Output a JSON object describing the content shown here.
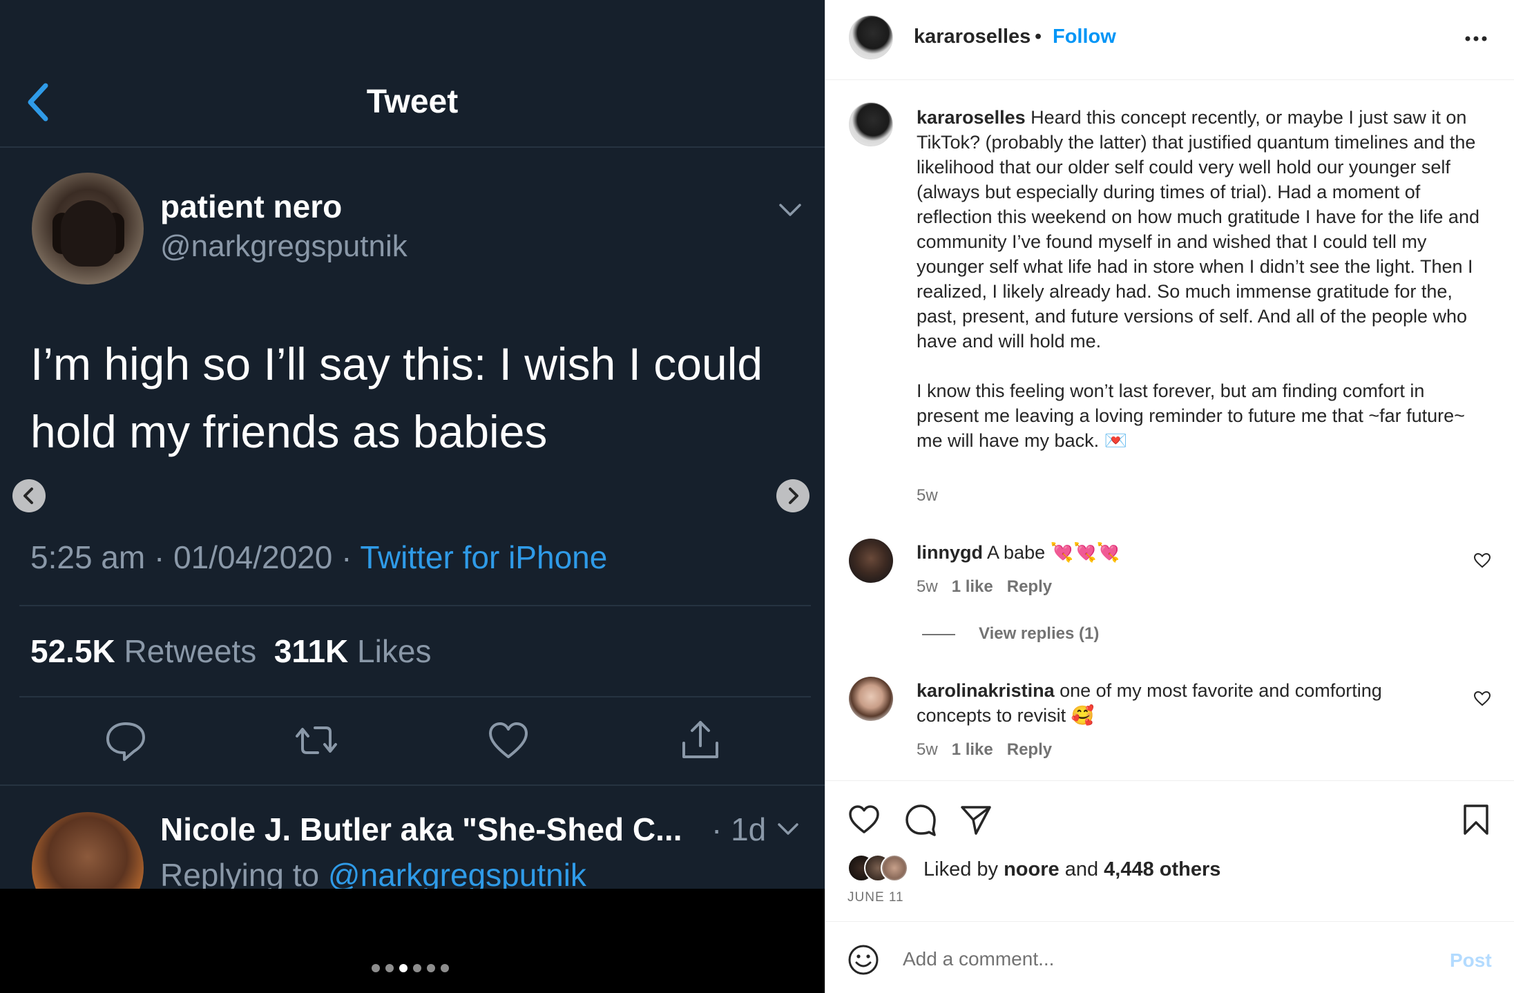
{
  "tweet": {
    "header_title": "Tweet",
    "author_name": "patient nero",
    "author_handle": "@narkgregsputnik",
    "text": "I’m high so I’ll say this: I wish I could hold my friends as babies",
    "time": "5:25 am · 01/04/2020 · ",
    "client": "Twitter for iPhone",
    "retweets_count": "52.5K",
    "retweets_label": " Retweets",
    "likes_count": "311K",
    "likes_label": " Likes",
    "reply": {
      "author_name": "Nicole J. Butler aka \"She-Shed C...",
      "time": "· 1d",
      "replying_prefix": "Replying to ",
      "replying_handle": "@narkgregsputnik"
    }
  },
  "carousel": {
    "dot_count": 6,
    "active_index": 2
  },
  "post": {
    "username": "kararoselles",
    "separator": "•",
    "follow_label": "Follow",
    "caption_user": "kararoselles",
    "caption_text": " Heard this concept recently, or maybe I just saw it on TikTok? (probably the latter) that justified quantum timelines and the likelihood that our older self could very well hold our younger self (always but especially during times of trial). Had a moment of reflection this weekend on how much gratitude I have for the life and community I’ve found myself in and wished that I could tell my younger self what life had in store when I didn’t see the light. Then I realized, I likely already had. So much immense gratitude for the, past, present, and future versions of self. And all of the people who have and will hold me.\n\nI know this feeling won’t last forever, but am finding comfort in present me leaving a loving reminder to future me that ~far future~ me will have my back. 💌",
    "caption_time": "5w",
    "comments": [
      {
        "user": "linnygd",
        "text": " A babe 💘💘💘",
        "time": "5w",
        "likes": "1 like",
        "reply": "Reply"
      },
      {
        "user": "karolinakristina",
        "text": " one of my most favorite and comforting concepts to revisit 🥰",
        "time": "5w",
        "likes": "1 like",
        "reply": "Reply"
      }
    ],
    "view_replies": "View replies (1)",
    "liked_by_prefix": "Liked by ",
    "liked_by_user": "noore",
    "liked_by_and": " and ",
    "liked_by_others": "4,448 others",
    "date": "JUNE 11",
    "add_comment_placeholder": "Add a comment...",
    "post_button": "Post"
  },
  "colors": {
    "accent": "#0095f6",
    "tweet_bg": "#16202c",
    "tweet_link": "#2f9be8",
    "muted": "#737373"
  }
}
